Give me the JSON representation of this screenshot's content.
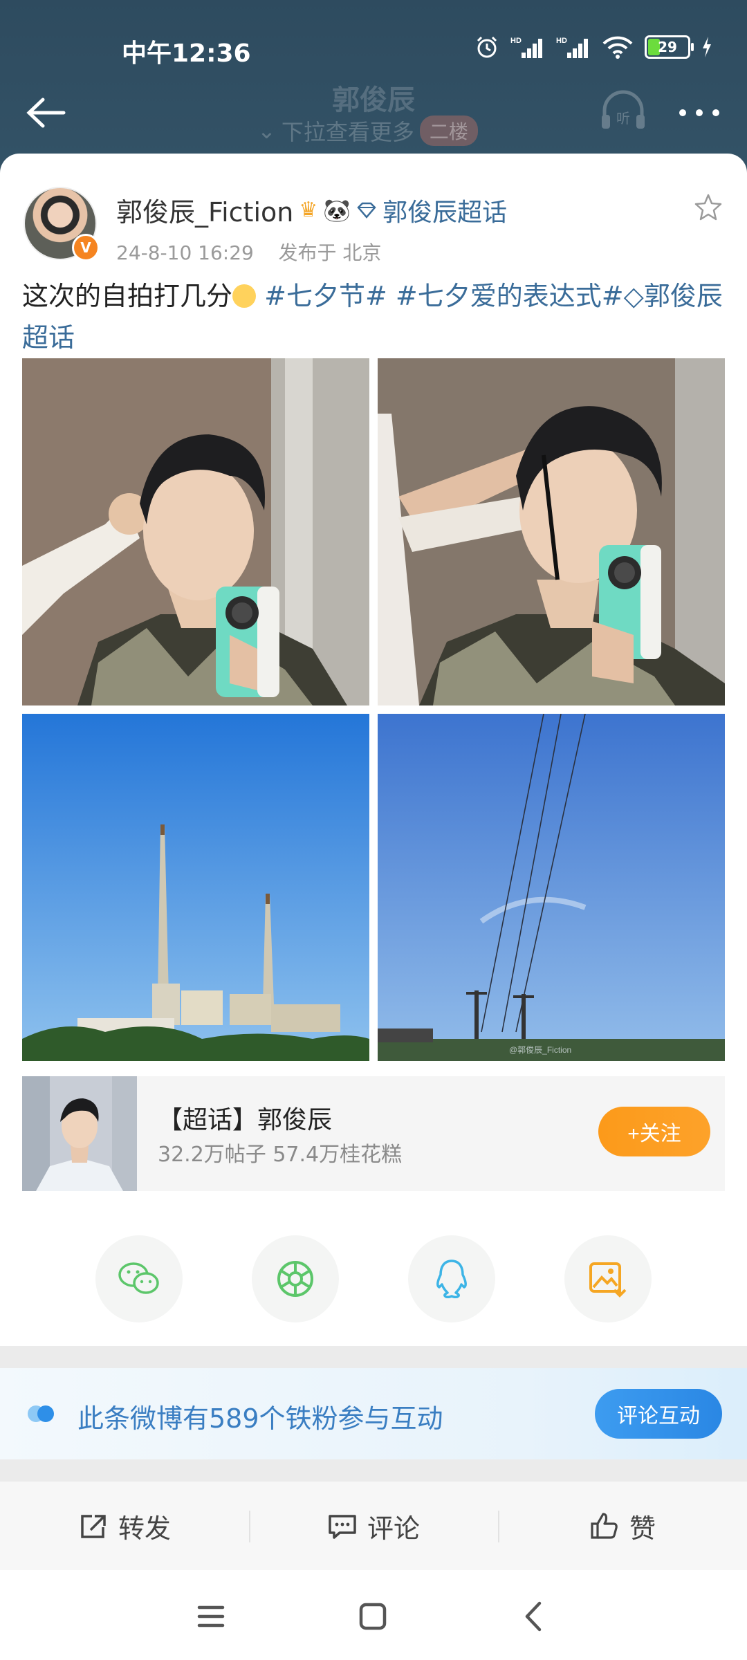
{
  "status_bar": {
    "time": "中午12:36",
    "battery": "29",
    "network_label_1": "HD",
    "network_label_2": "HD"
  },
  "nav": {
    "title": "郭俊辰",
    "pull_hint": "下拉查看更多",
    "floor_badge": "二楼",
    "listen_label": "听"
  },
  "post": {
    "username": "郭俊辰_Fiction",
    "super_topic_tag": "郭俊辰超话",
    "timestamp": "24-8-10 16:29",
    "location": "发布于 北京",
    "text_plain": "这次的自拍打几分",
    "hashtag_1": "#七夕节#",
    "hashtag_2": "#七夕爱的表达式#",
    "super_topic_link": "郭俊辰超话",
    "watermark": "@郭俊辰_Fiction"
  },
  "super_topic_card": {
    "title": "【超话】郭俊辰",
    "stats": "32.2万帖子 57.4万桂花糕",
    "follow_label": "+关注"
  },
  "share": {
    "items": [
      "wechat-icon",
      "moments-icon",
      "qq-icon",
      "save-image-icon"
    ]
  },
  "fans_banner": {
    "text": "此条微博有589个铁粉参与互动",
    "button_label": "评论互动"
  },
  "actions": {
    "repost_label": "转发",
    "comment_label": "评论",
    "like_label": "赞"
  },
  "colors": {
    "header_bg": "#2e4b5f",
    "link": "#3a6c99",
    "follow_orange": "#fc9a1a",
    "blue_button": "#2a87e4"
  }
}
